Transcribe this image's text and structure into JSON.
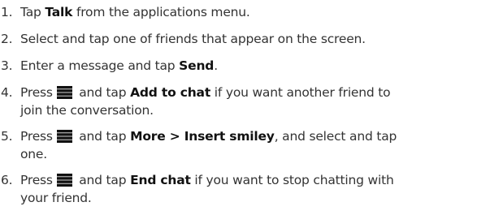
{
  "steps": [
    {
      "number": "1.",
      "pre": "Tap ",
      "bold": "Talk",
      "post": " from the applications menu."
    },
    {
      "number": "2.",
      "text": "Select and tap one of friends that appear on the screen."
    },
    {
      "number": "3.",
      "pre": "Enter a message and tap ",
      "bold": "Send",
      "post": "."
    },
    {
      "number": "4.",
      "pre": "Press ",
      "icon": "menu-icon",
      "mid": " and tap ",
      "bold": "Add to chat",
      "post": " if you want another friend to",
      "line2": "join the conversation."
    },
    {
      "number": "5.",
      "pre": "Press ",
      "icon": "menu-icon",
      "mid": " and tap ",
      "bold": "More > Insert smiley",
      "post": ", and select and tap",
      "line2": "one."
    },
    {
      "number": "6.",
      "pre": "Press ",
      "icon": "menu-icon",
      "mid": " and tap ",
      "bold": "End chat",
      "post": " if you want to stop chatting with",
      "line2": "your friend."
    }
  ]
}
